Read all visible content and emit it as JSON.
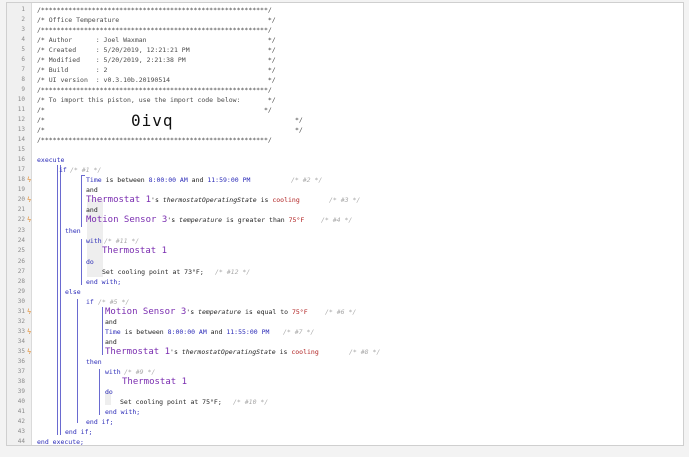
{
  "editor": {
    "line_numbers": [
      "1",
      "2",
      "3",
      "4",
      "5",
      "6",
      "7",
      "8",
      "9",
      "10",
      "11",
      "12",
      "13",
      "14",
      "15",
      "16",
      "17",
      "18",
      "19",
      "20",
      "21",
      "22",
      "23",
      "24",
      "25",
      "26",
      "27",
      "28",
      "29",
      "30",
      "31",
      "32",
      "33",
      "34",
      "35",
      "36",
      "37",
      "38",
      "39",
      "40",
      "41",
      "42",
      "43",
      "44"
    ],
    "header": {
      "border": "/**********************************************************/",
      "title": "/* Office Temperature                                      */",
      "author": "/* Author      : Joel Waxman                               */",
      "created": "/* Created     : 5/20/2019, 12:21:21 PM                    */",
      "modified": "/* Modified    : 5/20/2019, 2:21:38 PM                     */",
      "build": "/* Build       : 2                                         */",
      "ui_version": "/* UI version  : v0.3.10b.20190514                         */",
      "import_text": "/* To import this piston, use the import code below:       */",
      "blank": "/*                                                        */",
      "code_open": "/*",
      "code_close": "*/",
      "import_code": "0ivq"
    },
    "keywords": {
      "execute": "execute",
      "if": "if",
      "and": "and",
      "then": "then",
      "with": "with",
      "do": "do",
      "end_with": "end with;",
      "else": "else",
      "end_if": "end if;",
      "end_execute": "end execute;"
    },
    "comments": {
      "c1": "/* #1 */",
      "c2": "/* #2 */",
      "c3": "/* #3 */",
      "c4": "/* #4 */",
      "c5": "/* #5 */",
      "c6": "/* #6 */",
      "c7": "/* #7 */",
      "c8": "/* #8 */",
      "c9": "/* #9 */",
      "c10": "/* #10 */",
      "c11": "/* #11 */",
      "c12": "/* #12 */"
    },
    "conditions": {
      "time1": {
        "subject": "Time",
        "text": " is between ",
        "from": "8:00:00 AM",
        "and": " and ",
        "to": "11:59:00 PM"
      },
      "thermo1": {
        "device": "Thermostat 1",
        "poss": "'s ",
        "attr": "thermostatOperatingState",
        "op": " is ",
        "value": "cooling"
      },
      "motion1": {
        "device": "Motion Sensor 3",
        "poss": "'s ",
        "attr": "temperature",
        "op": " is greater than ",
        "value": "75°F"
      },
      "motion2": {
        "device": "Motion Sensor 3",
        "poss": "'s ",
        "attr": "temperature",
        "op": " is equal to ",
        "value": "75°F"
      },
      "time2": {
        "subject": "Time",
        "text": " is between ",
        "from": "8:00:00 AM",
        "and": " and ",
        "to": "11:55:00 PM"
      },
      "thermo2": {
        "device": "Thermostat 1",
        "poss": "'s ",
        "attr": "thermostatOperatingState",
        "op": " is ",
        "value": "cooling"
      }
    },
    "actions": {
      "with_device_1": "Thermostat 1",
      "task_1": "Set cooling point at 73°F;",
      "with_device_2": "Thermostat 1",
      "task_2": "Set cooling point at 75°F;"
    },
    "flag_icon": "lightning-icon",
    "colors": {
      "keyword": "#2b2bb8",
      "device": "#7a2db0",
      "value": "#b02020",
      "flag": "#e08a2e"
    }
  }
}
